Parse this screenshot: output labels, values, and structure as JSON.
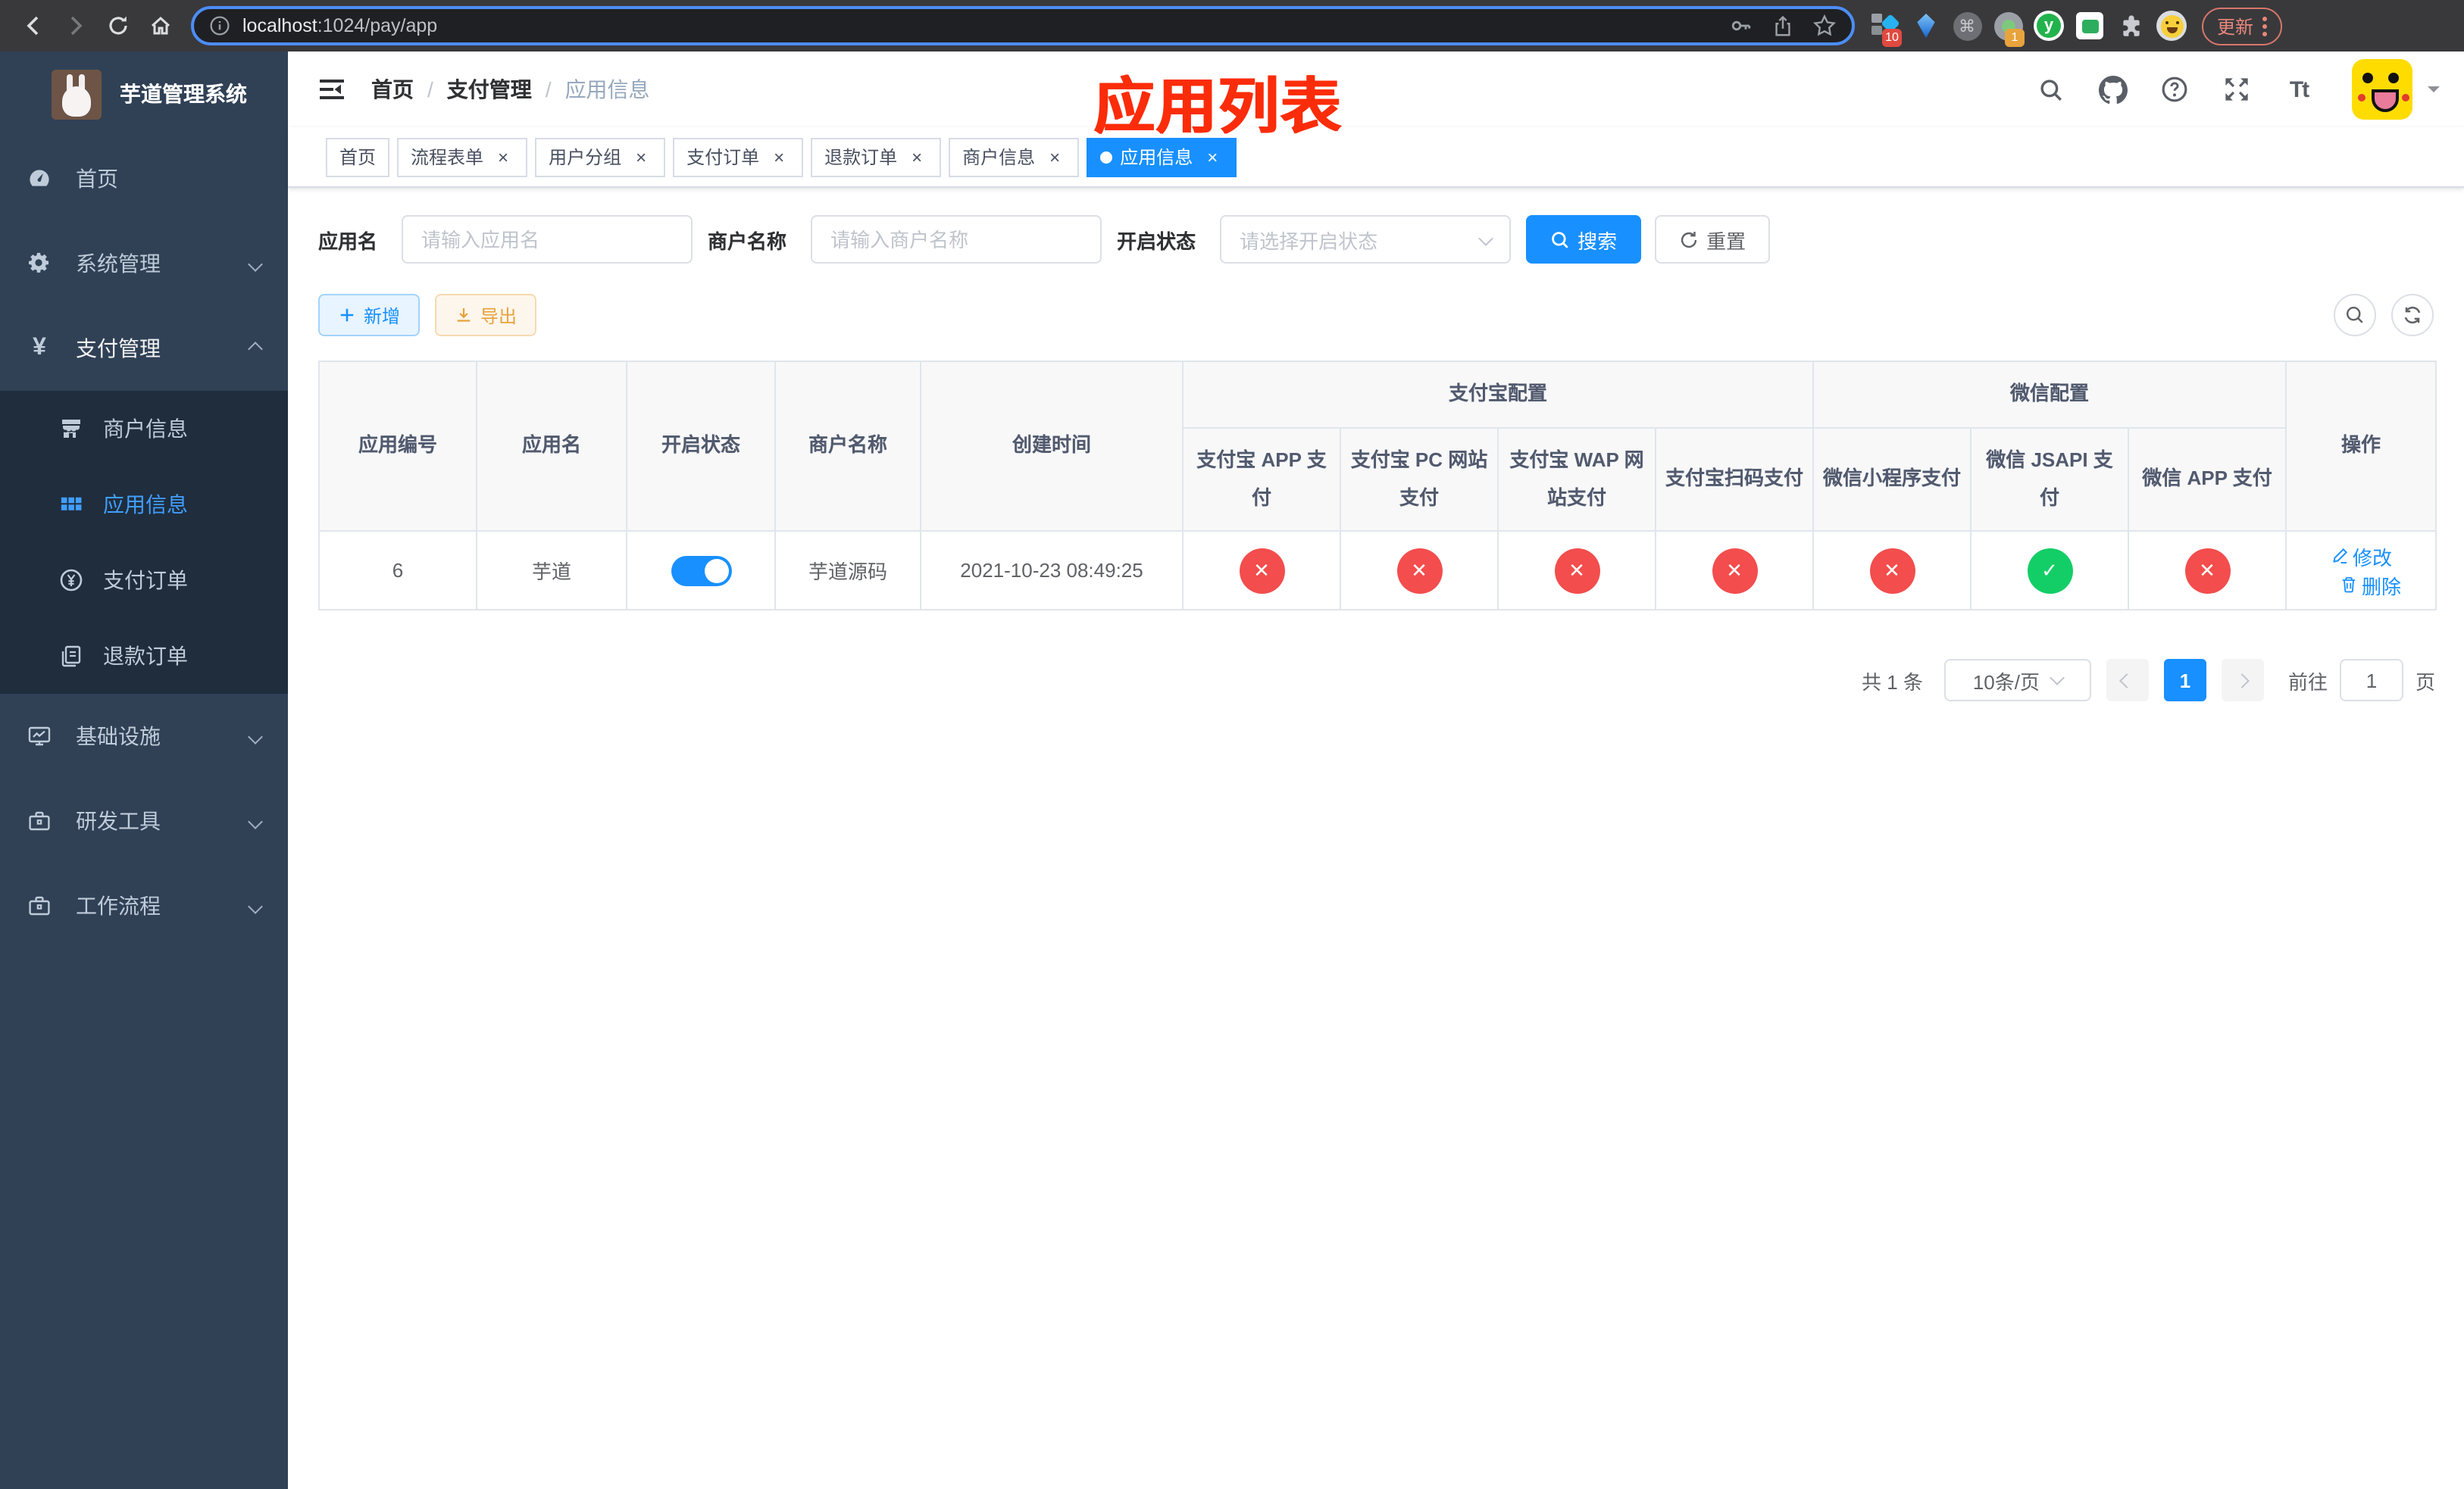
{
  "browser": {
    "url_domain": "localhost",
    "url_path": ":1024/pay/app",
    "update_button": "更新",
    "ext_badge_blue_diamond": "10",
    "ext_badge_record": "1",
    "ext_y_label": "y"
  },
  "annotation": "应用列表",
  "sidebar": {
    "title": "芋道管理系统",
    "items": {
      "home": "首页",
      "system": "系统管理",
      "pay": "支付管理",
      "merchant": "商户信息",
      "appinfo": "应用信息",
      "payorder": "支付订单",
      "refund": "退款订单",
      "infra": "基础设施",
      "devtool": "研发工具",
      "workflow": "工作流程"
    }
  },
  "navbar": {
    "breadcrumb": [
      "首页",
      "支付管理",
      "应用信息"
    ],
    "separator": "/"
  },
  "tabs": [
    {
      "label": "首页"
    },
    {
      "label": "流程表单"
    },
    {
      "label": "用户分组"
    },
    {
      "label": "支付订单"
    },
    {
      "label": "退款订单"
    },
    {
      "label": "商户信息"
    },
    {
      "label": "应用信息"
    }
  ],
  "filters": {
    "app_name_label": "应用名",
    "app_name_placeholder": "请输入应用名",
    "merchant_label": "商户名称",
    "merchant_placeholder": "请输入商户名称",
    "status_label": "开启状态",
    "status_placeholder": "请选择开启状态",
    "search": "搜索",
    "reset": "重置"
  },
  "toolbar": {
    "add": "新增",
    "export": "导出"
  },
  "table": {
    "columns": [
      "应用编号",
      "应用名",
      "开启状态",
      "商户名称",
      "创建时间"
    ],
    "alipay_group": "支付宝配置",
    "wechat_group": "微信配置",
    "channel_columns": [
      "支付宝 APP 支付",
      "支付宝 PC 网站支付",
      "支付宝 WAP 网站支付",
      "支付宝扫码支付",
      "微信小程序支付",
      "微信 JSAPI 支付",
      "微信 APP 支付"
    ],
    "action_column": "操作",
    "row": {
      "app_id": "6",
      "app_name": "芋道",
      "merchant_name": "芋道源码",
      "create_time": "2021-10-23 08:49:25",
      "channel_statuses": [
        "✕",
        "✕",
        "✕",
        "✕",
        "✕",
        "✓",
        "✕"
      ],
      "edit": "修改",
      "delete": "删除"
    }
  },
  "pagination": {
    "total": "共 1 条",
    "page_size": "10条/页",
    "page": "1",
    "goto_label": "前往",
    "goto_value": "1",
    "page_unit": "页"
  },
  "icons": {
    "yen": "¥",
    "font_size": "Tt",
    "close": "×",
    "command": "⌘"
  },
  "colors": {
    "primary": "#1890ff",
    "menu_active": "#409eff",
    "success": "#13ce66",
    "danger": "#f34d4d",
    "annotation_red": "#fb2c09",
    "sidebar_bg": "#304156",
    "submenu_bg": "#1f2d3d"
  }
}
